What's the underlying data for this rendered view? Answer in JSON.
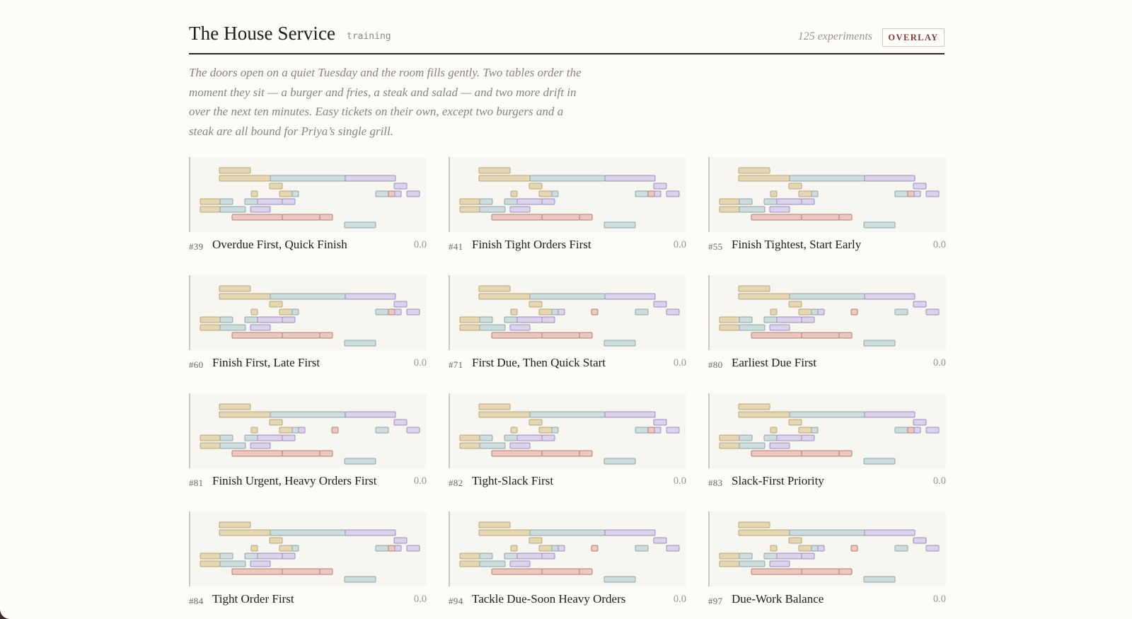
{
  "header": {
    "title": "The House Service",
    "tag": "training",
    "count": "125 experiments",
    "overlay_label": "OVERLAY"
  },
  "intro": "The doors open on a quiet Tuesday and the room fills gently. Two tables order the moment they sit — a burger and fries, a steak and salad — and two more drift in over the next ten minutes. Easy tickets on their own, except two burgers and a steak are all bound for Priya’s single grill.",
  "palette": {
    "tan": {
      "fill": "#e6d7b4",
      "stroke": "#b9a57a"
    },
    "blue": {
      "fill": "#cddcdc",
      "stroke": "#8fa6a8"
    },
    "lavender": {
      "fill": "#dcd2ec",
      "stroke": "#9d8dbc"
    },
    "pink": {
      "fill": "#ecc8c0",
      "stroke": "#b47e72"
    }
  },
  "experiments": [
    {
      "num": "#39",
      "name": "Overdue First, Quick Finish",
      "score": "0.0",
      "variant": "A"
    },
    {
      "num": "#41",
      "name": "Finish Tight Orders First",
      "score": "0.0",
      "variant": "A"
    },
    {
      "num": "#55",
      "name": "Finish Tightest, Start Early",
      "score": "0.0",
      "variant": "A"
    },
    {
      "num": "#60",
      "name": "Finish First, Late First",
      "score": "0.0",
      "variant": "A"
    },
    {
      "num": "#71",
      "name": "First Due, Then Quick Start",
      "score": "0.0",
      "variant": "B"
    },
    {
      "num": "#80",
      "name": "Earliest Due First",
      "score": "0.0",
      "variant": "B"
    },
    {
      "num": "#81",
      "name": "Finish Urgent, Heavy Orders First",
      "score": "0.0",
      "variant": "C"
    },
    {
      "num": "#82",
      "name": "Tight-Slack First",
      "score": "0.0",
      "variant": "A"
    },
    {
      "num": "#83",
      "name": "Slack-First Priority",
      "score": "0.0",
      "variant": "A"
    },
    {
      "num": "#84",
      "name": "Tight Order First",
      "score": "0.0",
      "variant": "A"
    },
    {
      "num": "#94",
      "name": "Tackle Due-Soon Heavy Orders",
      "score": "0.0",
      "variant": "B"
    },
    {
      "num": "#97",
      "name": "Due-Work Balance",
      "score": "0.0",
      "variant": "B"
    }
  ]
}
